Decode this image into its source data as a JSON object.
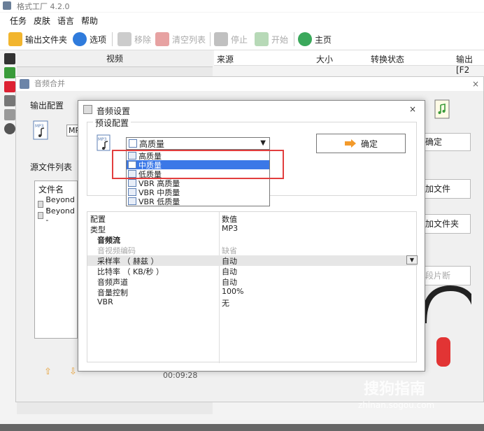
{
  "app": {
    "title": "格式工厂 4.2.0"
  },
  "menu": [
    "任务",
    "皮肤",
    "语言",
    "帮助"
  ],
  "toolbar": {
    "output_folder": "输出文件夹",
    "options": "选项",
    "remove": "移除",
    "clear_list": "清空列表",
    "stop": "停止",
    "start": "开始",
    "home": "主页"
  },
  "left_list": {
    "video_header": "视频"
  },
  "main_table": {
    "headers": [
      "来源",
      "大小",
      "转换状态",
      "输出 [F2"
    ]
  },
  "merge_window": {
    "title": "音频合并",
    "output_config": "输出配置",
    "mp_label": "MP",
    "source_files": "源文件列表",
    "file_name_header": "文件名",
    "files": [
      "Beyond -",
      "Beyond -"
    ],
    "confirm": "确定",
    "add_file": "加文件",
    "add_folder": "加文件夹",
    "clip": "段片断",
    "time": "00:09:28"
  },
  "dialog": {
    "title": "音频设置",
    "preset_label": "预设配置",
    "selected": "高质量",
    "ok": "确定",
    "options": [
      "高质量",
      "中质量",
      "低质量",
      "VBR 高质量",
      "VBR 中质量",
      "VBR 低质量"
    ],
    "selected_option_index": 1,
    "props": {
      "col_config": "配置",
      "col_value": "数值",
      "rows": [
        {
          "k": "类型",
          "v": "MP3"
        },
        {
          "k": "音频流",
          "v": ""
        },
        {
          "k": "音视频编码",
          "v": "缺省"
        },
        {
          "k": "采样率 （ 赫兹 ）",
          "v": "自动"
        },
        {
          "k": "比特率 （ KB/秒 ）",
          "v": "自动"
        },
        {
          "k": "音频声道",
          "v": "自动"
        },
        {
          "k": "音量控制",
          "v": "100%"
        },
        {
          "k": "VBR",
          "v": "无"
        }
      ]
    }
  },
  "watermark": {
    "line1": "搜狗指南",
    "line2": "zhinan.sogou.com"
  },
  "colors": {
    "highlight": "#e23e3e",
    "selected": "#3b78e7"
  }
}
